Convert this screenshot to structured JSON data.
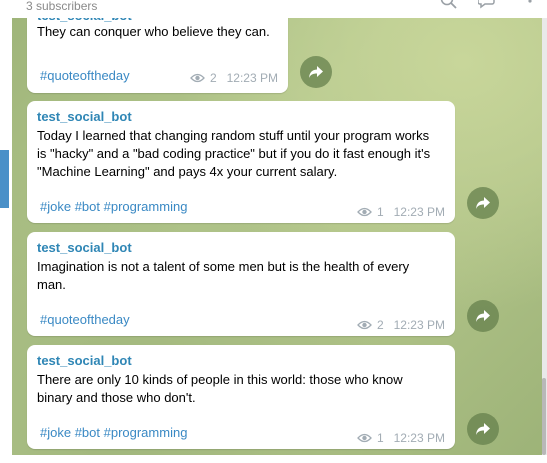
{
  "header": {
    "subscribers": "3 subscribers"
  },
  "messages": [
    {
      "sender": "test_social_bot",
      "text": "They can conquer who believe they can.",
      "tags": "#quoteoftheday",
      "views": "2",
      "time": "12:23 PM"
    },
    {
      "sender": "test_social_bot",
      "text": "Today I learned that changing random stuff until your program works is \"hacky\" and a \"bad coding practice\" but if you do it fast enough it's \"Machine Learning\" and pays 4x your current salary.",
      "tags": "#joke #bot #programming",
      "views": "1",
      "time": "12:23 PM"
    },
    {
      "sender": "test_social_bot",
      "text": "Imagination is not a talent of some men but is the health of every man.",
      "tags": "#quoteoftheday",
      "views": "2",
      "time": "12:23 PM"
    },
    {
      "sender": "test_social_bot",
      "text": "There are only 10 kinds of people in this world: those who know binary and those who don't.",
      "tags": "#joke #bot #programming",
      "views": "1",
      "time": "12:23 PM"
    }
  ],
  "icons": {
    "views": "eye-icon",
    "share": "share-arrow-icon",
    "search": "search-icon",
    "comments": "chat-bubbles-icon",
    "menu": "more-vertical-icon"
  },
  "colors": {
    "sender": "#2f86b5",
    "hashtag": "#3a89c4",
    "meta": "#a2acb4",
    "share_button": "#66804c",
    "chat_background": "#a8bd84"
  }
}
